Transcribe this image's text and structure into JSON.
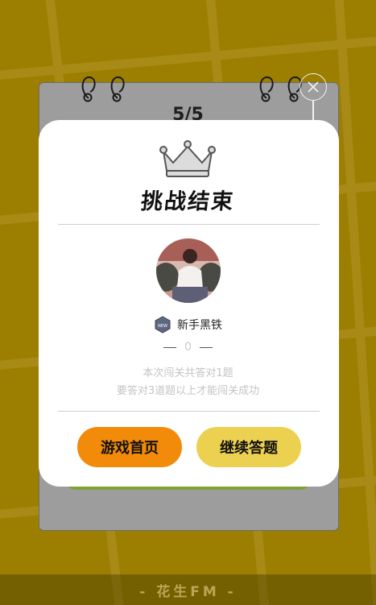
{
  "app": {
    "footer_brand": "- 花生FM -",
    "progress": "5/5"
  },
  "modal": {
    "title": "挑战结束",
    "rank_label": "新手黑铁",
    "rank_badge_text": "NEW",
    "score": "0",
    "result_line1": "本次闯关共答对1题",
    "result_line2": "要答对3道题以上才能闯关成功",
    "buttons": {
      "home": "游戏首页",
      "continue": "继续答题"
    }
  },
  "colors": {
    "background": "#9c7f00",
    "home_button": "#f28a0a",
    "continue_button": "#ecd050",
    "notepad": "#9d9d9d",
    "green_strip": "#7ea23a"
  },
  "icons": {
    "crown": "crown-icon",
    "close": "close-icon",
    "rank": "rank-badge-icon"
  }
}
